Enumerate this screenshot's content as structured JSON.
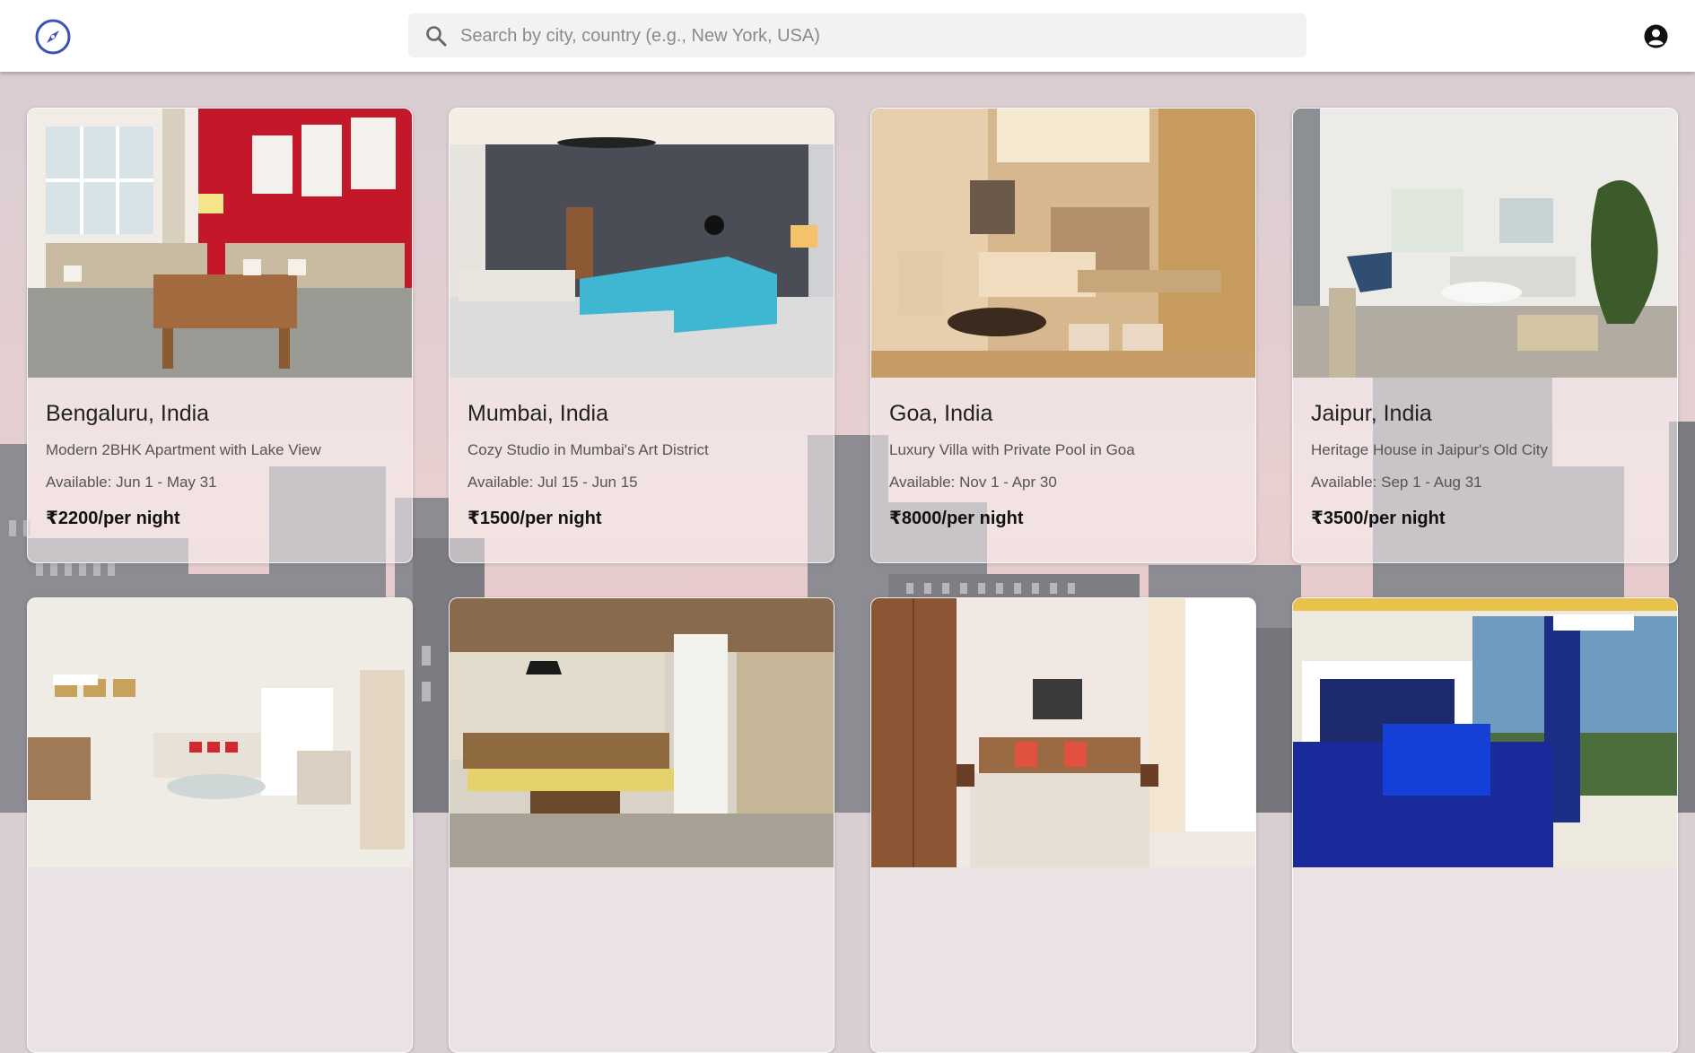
{
  "header": {
    "logo_icon": "compass-icon",
    "search": {
      "icon": "search-icon",
      "placeholder": "Search by city, country (e.g., New York, USA)"
    },
    "account_icon": "account-circle-icon"
  },
  "colors": {
    "logo": "#3f51b5",
    "header_bg": "#ffffff",
    "price": "#111111"
  },
  "listings": [
    {
      "city": "Bengaluru, India",
      "title": "Modern 2BHK Apartment with Lake View",
      "available": "Available: Jun 1 - May 31",
      "price": "₹2200/per night"
    },
    {
      "city": "Mumbai, India",
      "title": "Cozy Studio in Mumbai's Art District",
      "available": "Available: Jul 15 - Jun 15",
      "price": "₹1500/per night"
    },
    {
      "city": "Goa, India",
      "title": "Luxury Villa with Private Pool in Goa",
      "available": "Available: Nov 1 - Apr 30",
      "price": "₹8000/per night"
    },
    {
      "city": "Jaipur, India",
      "title": "Heritage House in Jaipur's Old City",
      "available": "Available: Sep 1 - Aug 31",
      "price": "₹3500/per night"
    }
  ]
}
